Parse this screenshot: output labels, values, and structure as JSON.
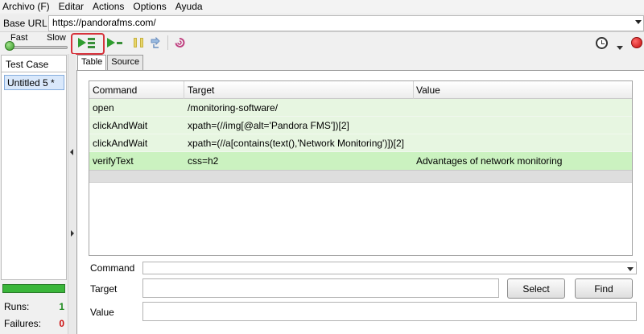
{
  "menu": [
    "Archivo (F)",
    "Editar",
    "Actions",
    "Options",
    "Ayuda"
  ],
  "base_url": {
    "label": "Base URL",
    "value": "https://pandorafms.com/"
  },
  "toolbar": {
    "speed_fast": "Fast",
    "speed_slow": "Slow",
    "speed_value": 0,
    "icons": [
      "play-suite-icon",
      "play-test-icon",
      "pause-icon",
      "step-icon",
      "rollup-icon",
      "schedule-clock-icon",
      "record-icon"
    ]
  },
  "left_panel": {
    "header": "Test Case",
    "items": [
      "Untitled 5 *"
    ],
    "runs_label": "Runs:",
    "runs_value": "1",
    "failures_label": "Failures:",
    "failures_value": "0"
  },
  "tabs": [
    "Table",
    "Source"
  ],
  "table": {
    "columns": [
      "Command",
      "Target",
      "Value"
    ],
    "rows": [
      {
        "command": "open",
        "target": "/monitoring-software/",
        "value": ""
      },
      {
        "command": "clickAndWait",
        "target": "xpath=(//img[@alt='Pandora FMS'])[2]",
        "value": ""
      },
      {
        "command": "clickAndWait",
        "target": "xpath=(//a[contains(text(),'Network Monitoring')])[2]",
        "value": ""
      },
      {
        "command": "verifyText",
        "target": "css=h2",
        "value": "Advantages of network monitoring"
      }
    ]
  },
  "form": {
    "command_label": "Command",
    "target_label": "Target",
    "value_label": "Value",
    "command_value": "",
    "target_value": "",
    "value_value": "",
    "select_button": "Select",
    "find_button": "Find"
  },
  "colors": {
    "row_bg": "#e7f6e1",
    "row_selected_bg": "#cbf2c0",
    "runs": "#1d8a1d",
    "failures": "#cc1010",
    "highlight": "#d6333c"
  }
}
